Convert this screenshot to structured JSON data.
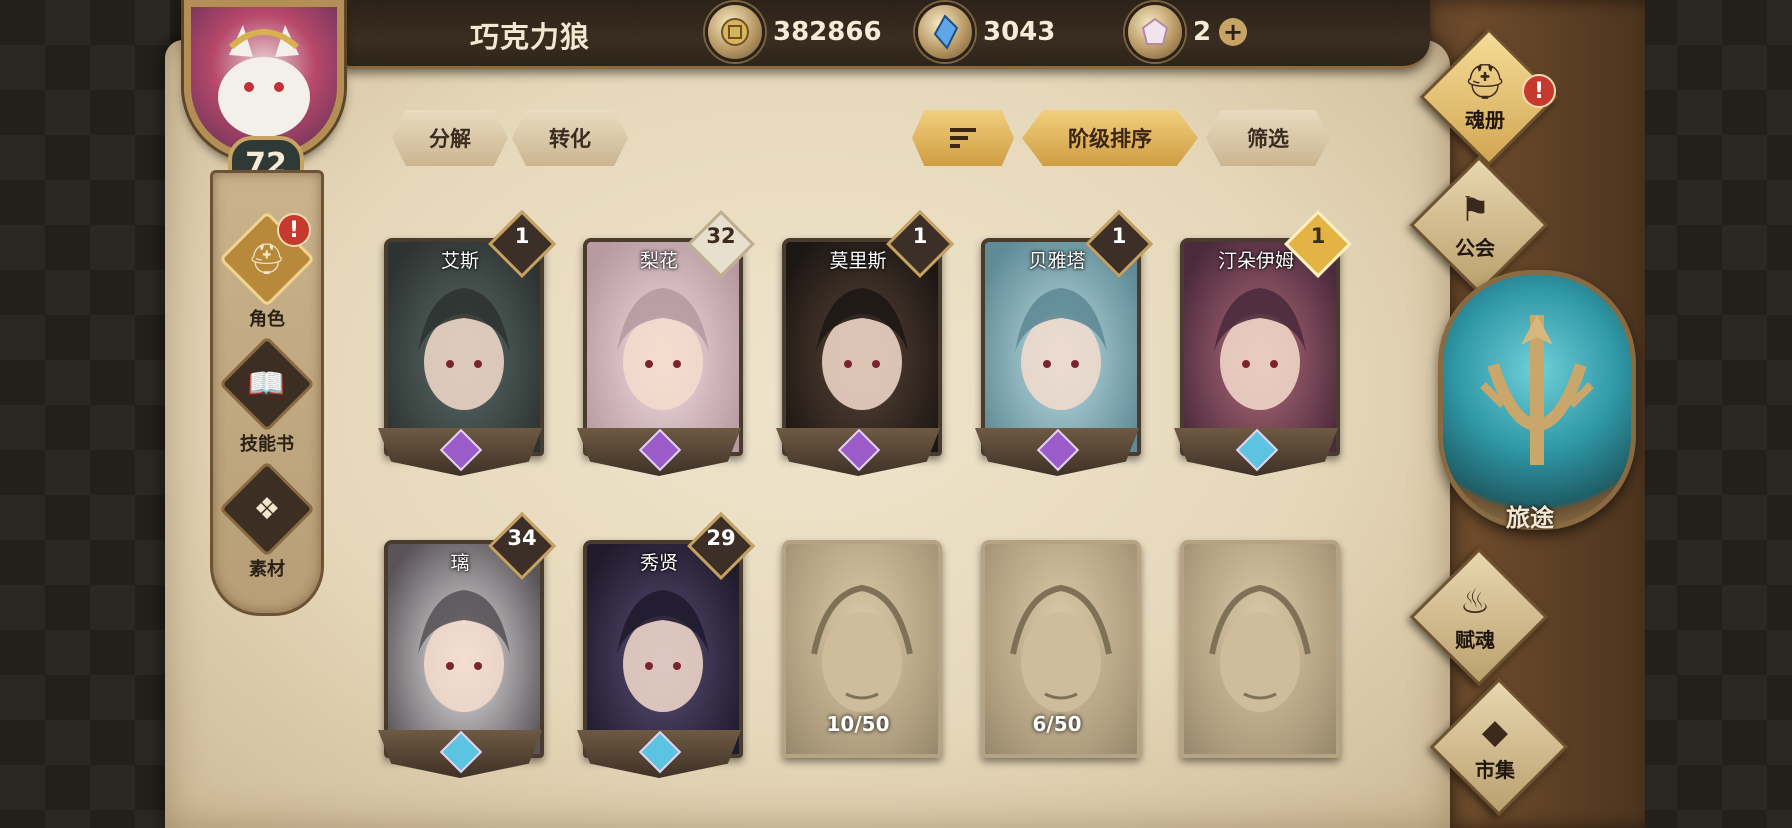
{
  "player": {
    "name": "巧克力狼",
    "level": "72"
  },
  "resources": {
    "gold": "382866",
    "crystal": "3043",
    "gem": "2"
  },
  "left_nav": [
    {
      "label": "角色",
      "icon": "helmet-icon",
      "active": true,
      "alert": "!"
    },
    {
      "label": "技能书",
      "icon": "book-icon",
      "active": false
    },
    {
      "label": "素材",
      "icon": "beast-icon",
      "active": false
    }
  ],
  "toolbar": {
    "decompose": "分解",
    "convert": "转化",
    "sort_by_rank": "阶级排序",
    "filter": "筛选"
  },
  "cards": [
    {
      "name": "艾斯",
      "count": "1",
      "badge": "dark",
      "unlocked": true,
      "gem": "purple",
      "c1": "#5c6d6a",
      "c2": "#2d3331"
    },
    {
      "name": "梨花",
      "count": "32",
      "badge": "light",
      "unlocked": true,
      "gem": "purple",
      "c1": "#f2dde0",
      "c2": "#b79aa2"
    },
    {
      "name": "莫里斯",
      "count": "1",
      "badge": "dark",
      "unlocked": true,
      "gem": "purple",
      "c1": "#5b4638",
      "c2": "#1d1714"
    },
    {
      "name": "贝雅塔",
      "count": "1",
      "badge": "dark",
      "unlocked": true,
      "gem": "purple",
      "c1": "#bcdce4",
      "c2": "#5f8b96"
    },
    {
      "name": "汀朵伊姆",
      "count": "1",
      "badge": "gold",
      "unlocked": true,
      "gem": "blue",
      "c1": "#b36d7a",
      "c2": "#4b2a3d"
    },
    {
      "name": "璃",
      "count": "34",
      "badge": "dark",
      "unlocked": true,
      "gem": "blue",
      "c1": "#e9e9ea",
      "c2": "#5a5458"
    },
    {
      "name": "秀贤",
      "count": "29",
      "badge": "dark",
      "unlocked": true,
      "gem": "blue",
      "c1": "#5d4f78",
      "c2": "#1f1b2c"
    },
    {
      "name": "",
      "progress": "10/50",
      "unlocked": false
    },
    {
      "name": "",
      "progress": "6/50",
      "unlocked": false
    },
    {
      "name": "",
      "progress": "",
      "unlocked": false
    }
  ],
  "side_menu": [
    {
      "label": "魂册",
      "icon": "helmet-icon",
      "alert": "!"
    },
    {
      "label": "公会",
      "icon": "guild-banner-icon"
    },
    {
      "label": "旅途",
      "icon": "trident-emblem-icon"
    },
    {
      "label": "赋魂",
      "icon": "swirl-icon"
    },
    {
      "label": "市集",
      "icon": "diamond-icon"
    }
  ]
}
